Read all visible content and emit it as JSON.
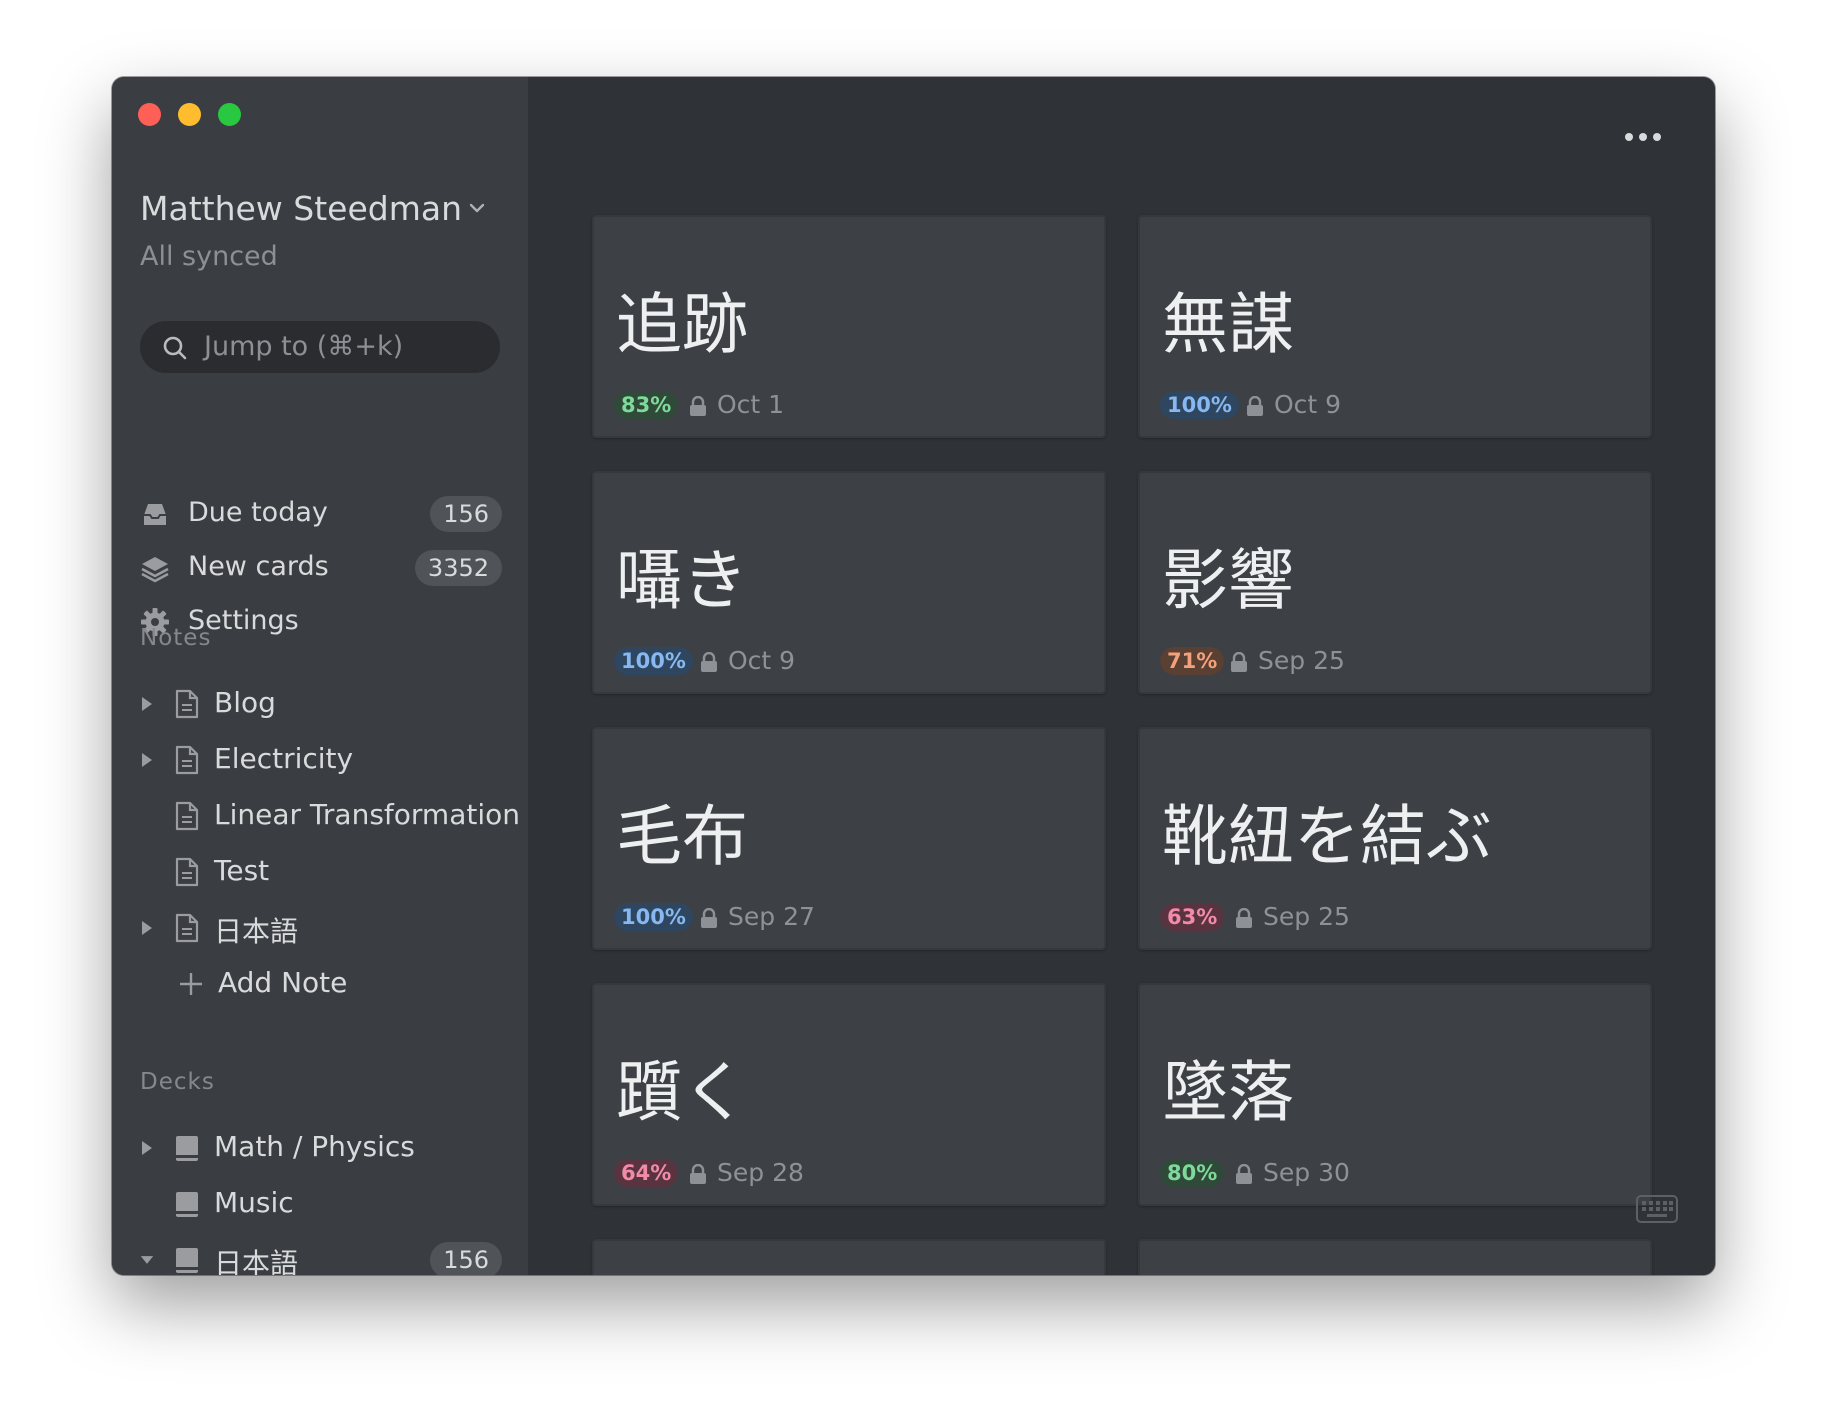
{
  "user": {
    "name": "Matthew Steedman",
    "status": "All synced"
  },
  "search": {
    "placeholder": "Jump to (⌘+k)"
  },
  "nav": [
    {
      "label": "Due today",
      "count": "156",
      "icon": "tray-icon"
    },
    {
      "label": "New cards",
      "count": "3352",
      "icon": "layers-icon"
    },
    {
      "label": "Settings",
      "icon": "gear-icon"
    }
  ],
  "notes": {
    "heading": "Notes",
    "items": [
      {
        "label": "Blog",
        "expandable": true
      },
      {
        "label": "Electricity",
        "expandable": true
      },
      {
        "label": "Linear Transformation",
        "expandable": false
      },
      {
        "label": "Test",
        "expandable": false
      },
      {
        "label": "日本語",
        "expandable": true
      }
    ],
    "add_label": "Add Note"
  },
  "decks": {
    "heading": "Decks",
    "items": [
      {
        "label": "Math / Physics",
        "expandable": true,
        "expanded": false
      },
      {
        "label": "Music",
        "expandable": false
      },
      {
        "label": "日本語",
        "expandable": true,
        "expanded": true,
        "count": "156"
      }
    ]
  },
  "cards": [
    {
      "word": "追跡",
      "percent": "83%",
      "date": "Oct 1",
      "tone": "green"
    },
    {
      "word": "無謀",
      "percent": "100%",
      "date": "Oct 9",
      "tone": "blue"
    },
    {
      "word": "囁き",
      "percent": "100%",
      "date": "Oct 9",
      "tone": "blue"
    },
    {
      "word": "影響",
      "percent": "71%",
      "date": "Sep 25",
      "tone": "orange"
    },
    {
      "word": "毛布",
      "percent": "100%",
      "date": "Sep 27",
      "tone": "blue"
    },
    {
      "word": "靴紐を結ぶ",
      "percent": "63%",
      "date": "Sep 25",
      "tone": "pink"
    },
    {
      "word": "躓く",
      "percent": "64%",
      "date": "Sep 28",
      "tone": "pink"
    },
    {
      "word": "墜落",
      "percent": "80%",
      "date": "Sep 30",
      "tone": "green"
    }
  ],
  "colors": {
    "sidebar_bg": "#3a3d41",
    "main_bg": "#2f3236",
    "card_bg": "#3d4044",
    "text": "#d9dadb",
    "muted": "#8c8f93"
  }
}
